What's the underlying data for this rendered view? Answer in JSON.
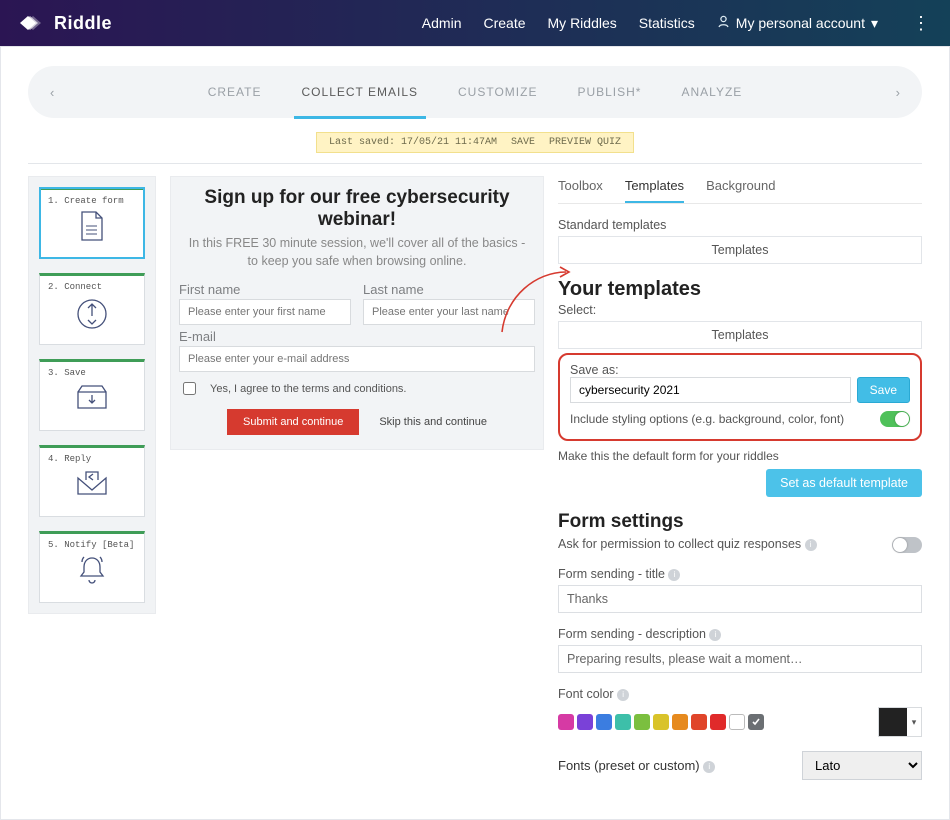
{
  "brand": "Riddle",
  "topnav": {
    "admin": "Admin",
    "create": "Create",
    "myriddles": "My Riddles",
    "statistics": "Statistics",
    "account": "My personal account"
  },
  "tabs": {
    "create": "CREATE",
    "collect": "COLLECT EMAILS",
    "customize": "CUSTOMIZE",
    "publish": "PUBLISH*",
    "analyze": "ANALYZE"
  },
  "saved": {
    "text": "Last saved: 17/05/21 11:47AM",
    "save": "SAVE",
    "preview": "PREVIEW QUIZ"
  },
  "steps": {
    "s1": "1. Create form",
    "s2": "2. Connect",
    "s3": "3. Save",
    "s4": "4. Reply",
    "s5": "5. Notify [Beta]"
  },
  "preview": {
    "title": "Sign up for our free cybersecurity webinar!",
    "sub": "In this FREE 30 minute session, we'll cover all of the basics - to keep you safe when browsing online.",
    "first_label": "First name",
    "first_ph": "Please enter your first name",
    "last_label": "Last name",
    "last_ph": "Please enter your last name",
    "email_label": "E-mail",
    "email_ph": "Please enter your e-mail address",
    "consent": "Yes, I agree to the terms and conditions.",
    "submit": "Submit and continue",
    "skip": "Skip this and continue"
  },
  "rtabs": {
    "toolbox": "Toolbox",
    "templates": "Templates",
    "background": "Background"
  },
  "std": {
    "label": "Standard templates",
    "btn": "Templates"
  },
  "your": {
    "title": "Your templates",
    "select": "Select:",
    "btn": "Templates"
  },
  "saveas": {
    "label": "Save as:",
    "value": "cybersecurity 2021",
    "btn": "Save",
    "include": "Include styling options (e.g. background, color, font)"
  },
  "default": {
    "note": "Make this the default form for your riddles",
    "btn": "Set as default template"
  },
  "form": {
    "title": "Form settings",
    "ask": "Ask for permission to collect quiz responses",
    "send_title_label": "Form sending - title",
    "send_title_value": "Thanks",
    "send_desc_label": "Form sending - description",
    "send_desc_value": "Preparing results, please wait a moment…",
    "fontcolor": "Font color",
    "fonts_label": "Fonts (preset or custom)",
    "fonts_value": "Lato"
  },
  "swatch_colors": [
    "#d63aa4",
    "#7a41d8",
    "#3b7de0",
    "#3dbfa9",
    "#7bbf3f",
    "#d9c32a",
    "#e68a1e",
    "#e0452a",
    "#e02a2a"
  ]
}
